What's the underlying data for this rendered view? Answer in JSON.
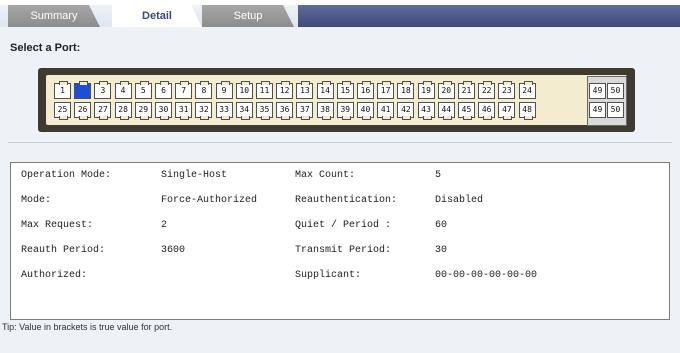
{
  "tabs": [
    {
      "label": "Summary",
      "active": false
    },
    {
      "label": "Detail",
      "active": true
    },
    {
      "label": "Setup",
      "active": false
    }
  ],
  "port_section": {
    "label": "Select a Port:",
    "selected_port": "2",
    "top_row": [
      "1",
      "2",
      "3",
      "4",
      "5",
      "6",
      "7",
      "8",
      "9",
      "10",
      "11",
      "12",
      "13",
      "14",
      "15",
      "16",
      "17",
      "18",
      "19",
      "20",
      "21",
      "22",
      "23",
      "24"
    ],
    "bottom_row": [
      "25",
      "26",
      "27",
      "28",
      "29",
      "30",
      "31",
      "32",
      "33",
      "34",
      "35",
      "36",
      "37",
      "38",
      "39",
      "40",
      "41",
      "42",
      "43",
      "44",
      "45",
      "46",
      "47",
      "48"
    ],
    "uplink_top": [
      "49",
      "50"
    ],
    "uplink_bottom": [
      "49",
      "50"
    ]
  },
  "details": {
    "rows": [
      {
        "label1": "Operation Mode:",
        "value1": "Single-Host",
        "label2": "Max Count:",
        "value2": "5"
      },
      {
        "label1": "Mode:",
        "value1": "Force-Authorized",
        "label2": "Reauthentication:",
        "value2": "Disabled"
      },
      {
        "label1": "Max Request:",
        "value1": "2",
        "label2": "Quiet / Period :",
        "value2": "60"
      },
      {
        "label1": "Reauth Period:",
        "value1": "3600",
        "label2": "Transmit Period:",
        "value2": "30"
      },
      {
        "label1": "Authorized:",
        "value1": "",
        "label2": "Supplicant:",
        "value2": "00-00-00-00-00-00"
      }
    ]
  },
  "tip": "Tip: Value in brackets is true value for port.",
  "colors": {
    "accent": "#3e4a7a",
    "selected_port": "#1c4fd8",
    "switch_frame": "#3e3931",
    "switch_face": "#f3ecce"
  }
}
